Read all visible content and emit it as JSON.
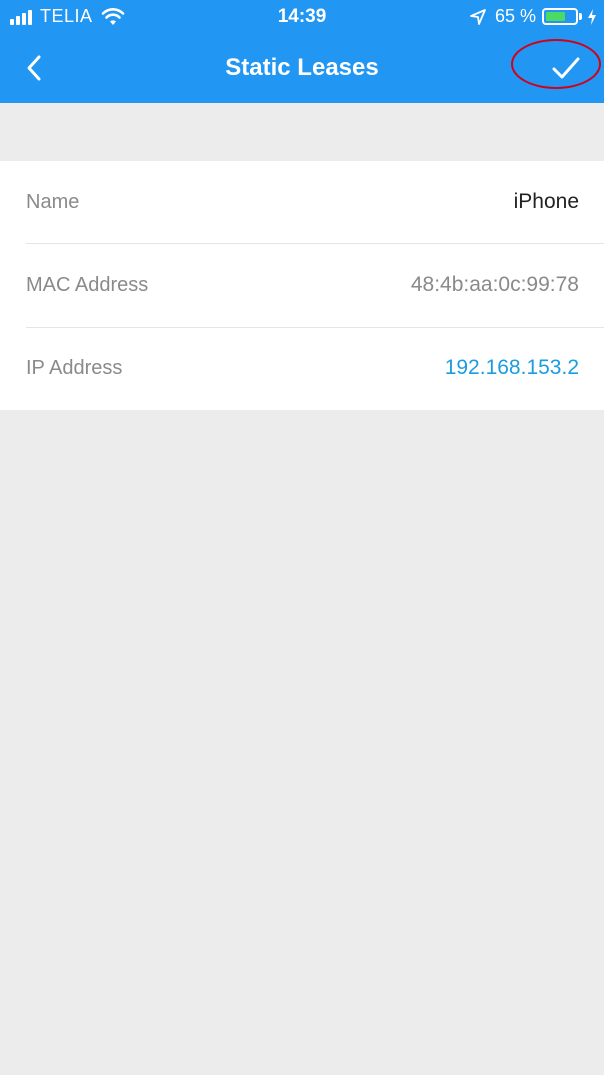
{
  "status_bar": {
    "carrier": "TELIA",
    "time": "14:39",
    "battery_percent": "65 %",
    "battery_level": 0.65
  },
  "nav": {
    "title": "Static Leases"
  },
  "lease": {
    "rows": [
      {
        "label": "Name",
        "value": "iPhone",
        "value_color": "#222222"
      },
      {
        "label": "MAC Address",
        "value": "48:4b:aa:0c:99:78",
        "value_color": "#8a8a8a"
      },
      {
        "label": "IP Address",
        "value": "192.168.153.2",
        "value_color": "#1a9de0"
      }
    ]
  },
  "colors": {
    "header_bg": "#2196f3",
    "page_bg": "#ececec",
    "highlight_ring": "#d0021b"
  }
}
